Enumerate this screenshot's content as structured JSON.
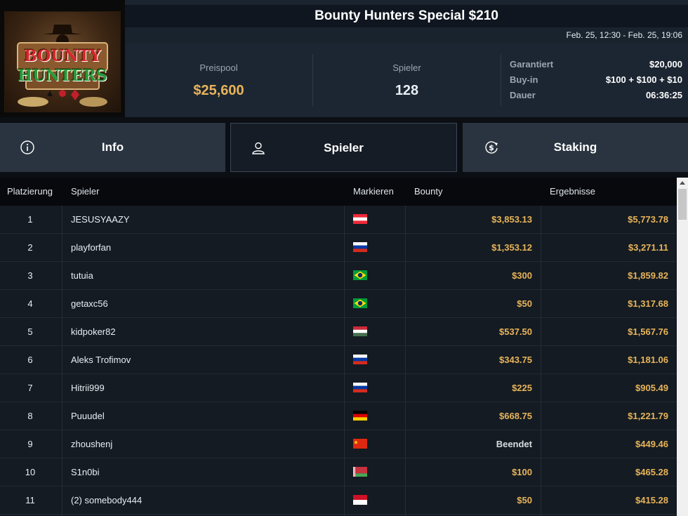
{
  "logo": {
    "line1": "BOUNTY",
    "line2": "HUNTERS"
  },
  "tournament": {
    "title": "Bounty Hunters Special $210",
    "dates": "Feb. 25, 12:30 - Feb. 25, 19:06"
  },
  "stats": {
    "prizepool_label": "Preispool",
    "prizepool_value": "$25,600",
    "players_label": "Spieler",
    "players_value": "128",
    "guaranteed_label": "Garantiert",
    "guaranteed_value": "$20,000",
    "buyin_label": "Buy-in",
    "buyin_value": "$100 + $100 + $10",
    "duration_label": "Dauer",
    "duration_value": "06:36:25"
  },
  "tabs": [
    {
      "label": "Info",
      "icon": "info-icon"
    },
    {
      "label": "Spieler",
      "icon": "user-icon",
      "active": true
    },
    {
      "label": "Staking",
      "icon": "dollar-cycle-icon"
    }
  ],
  "table": {
    "headers": {
      "place": "Platzierung",
      "player": "Spieler",
      "flag": "Markieren",
      "bounty": "Bounty",
      "results": "Ergebnisse"
    },
    "rows": [
      {
        "place": "1",
        "player": "JESUSYAAZY",
        "flag": "austria",
        "bounty": "$3,853.13",
        "result": "$5,773.78"
      },
      {
        "place": "2",
        "player": "playforfan",
        "flag": "russia",
        "bounty": "$1,353.12",
        "result": "$3,271.11"
      },
      {
        "place": "3",
        "player": "tutuia",
        "flag": "brazil",
        "bounty": "$300",
        "result": "$1,859.82"
      },
      {
        "place": "4",
        "player": "getaxc56",
        "flag": "brazil",
        "bounty": "$50",
        "result": "$1,317.68"
      },
      {
        "place": "5",
        "player": "kidpoker82",
        "flag": "hungary",
        "bounty": "$537.50",
        "result": "$1,567.76"
      },
      {
        "place": "6",
        "player": "Aleks Trofimov",
        "flag": "russia",
        "bounty": "$343.75",
        "result": "$1,181.06"
      },
      {
        "place": "7",
        "player": "Hitrii999",
        "flag": "russia",
        "bounty": "$225",
        "result": "$905.49"
      },
      {
        "place": "8",
        "player": "Puuudel",
        "flag": "germany",
        "bounty": "$668.75",
        "result": "$1,221.79"
      },
      {
        "place": "9",
        "player": "zhoushenj",
        "flag": "china",
        "bounty": "Beendet",
        "result": "$449.46"
      },
      {
        "place": "10",
        "player": "S1n0bi",
        "flag": "belarus",
        "bounty": "$100",
        "result": "$465.28"
      },
      {
        "place": "11",
        "player": "(2) somebody444",
        "flag": "indonesia",
        "bounty": "$50",
        "result": "$415.28"
      }
    ]
  },
  "colors": {
    "accent": "#e8b45a",
    "panel": "#1c2632",
    "tab": "#2a3440"
  }
}
